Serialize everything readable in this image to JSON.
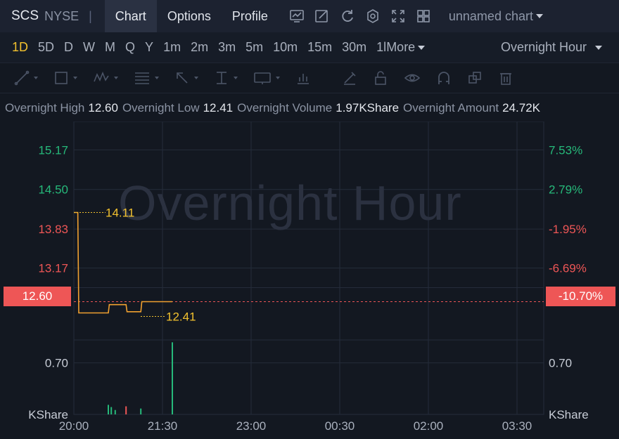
{
  "header": {
    "symbol": "SCS",
    "exchange": "NYSE",
    "separator": "|",
    "tabs": [
      {
        "label": "Chart",
        "active": true
      },
      {
        "label": "Options",
        "active": false
      },
      {
        "label": "Profile",
        "active": false
      }
    ],
    "toolbar_icons": [
      "indicator-icon",
      "draw-icon",
      "refresh-icon",
      "settings-icon",
      "fullscreen-icon",
      "layout-grid-icon"
    ],
    "chart_name": "unnamed chart"
  },
  "intervals": {
    "items": [
      "1D",
      "5D",
      "D",
      "W",
      "M",
      "Q",
      "Y",
      "1m",
      "2m",
      "3m",
      "5m",
      "10m",
      "15m",
      "30m",
      "1h"
    ],
    "active": "1D",
    "truncated_label": "1l",
    "more_label": "More",
    "session_label": "Overnight Hour"
  },
  "draw_tools": [
    "trendline-icon",
    "rectangle-icon",
    "pattern-icon",
    "fib-icon",
    "arrow-icon",
    "measure-icon",
    "text-icon",
    "long-short-icon",
    "pencil-icon",
    "lock-icon",
    "eye-icon",
    "magnet-icon",
    "copy-icon",
    "trash-icon"
  ],
  "info_bar": {
    "high_label": "Overnight High",
    "high_value": "12.60",
    "low_label": "Overnight Low",
    "low_value": "12.41",
    "volume_label": "Overnight Volume",
    "volume_value": "1.97KShare",
    "amount_label": "Overnight Amount",
    "amount_value": "24.72K"
  },
  "watermark": "Overnight Hour",
  "colors": {
    "up": "#26b97a",
    "down": "#ee5656",
    "line": "#f0a030",
    "marker": "#f2c12e",
    "background": "#131821"
  },
  "chart_data": {
    "type": "line",
    "price_axis": {
      "labels": [
        {
          "price": 15.17,
          "text": "15.17",
          "pct": "7.53%",
          "dir": "up"
        },
        {
          "price": 14.5,
          "text": "14.50",
          "pct": "2.79%",
          "dir": "up"
        },
        {
          "price": 13.83,
          "text": "13.83",
          "pct": "-1.95%",
          "dir": "down"
        },
        {
          "price": 13.17,
          "text": "13.17",
          "pct": "-6.69%",
          "dir": "down"
        }
      ],
      "range": [
        12.0,
        15.65
      ]
    },
    "last_price": {
      "text": "12.60",
      "pct": "-10.70%"
    },
    "high_marker": "14.11",
    "low_marker": "12.41",
    "volume_axis": {
      "label": "0.70",
      "unit": "KShare",
      "range": [
        0,
        1.05
      ]
    },
    "time_labels": [
      "20:00",
      "21:30",
      "23:00",
      "00:30",
      "02:00",
      "03:30"
    ],
    "price_series": {
      "x": [
        "20:00",
        "20:04",
        "20:05",
        "20:35",
        "20:36",
        "20:53",
        "20:54",
        "21:08",
        "21:09",
        "21:40"
      ],
      "y": [
        14.11,
        14.11,
        12.41,
        12.41,
        12.55,
        12.55,
        12.43,
        12.43,
        12.6,
        12.6
      ]
    },
    "volume_series": [
      {
        "x": "20:35",
        "v": 0.13,
        "dir": "up"
      },
      {
        "x": "20:38",
        "v": 0.1,
        "dir": "up"
      },
      {
        "x": "20:42",
        "v": 0.06,
        "dir": "up"
      },
      {
        "x": "20:53",
        "v": 0.11,
        "dir": "down"
      },
      {
        "x": "21:08",
        "v": 0.08,
        "dir": "up"
      },
      {
        "x": "21:40",
        "v": 0.98,
        "dir": "up"
      }
    ]
  }
}
